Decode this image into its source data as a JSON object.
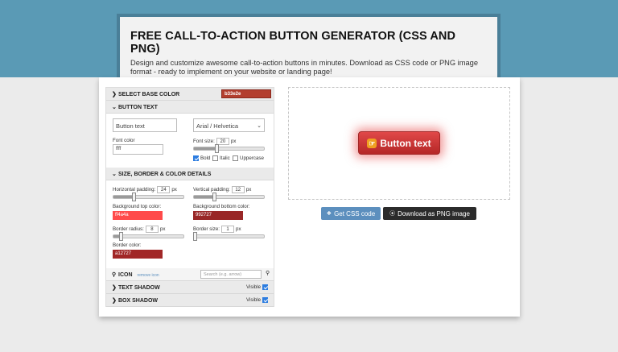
{
  "header": {
    "title": "FREE CALL-TO-ACTION BUTTON GENERATOR (CSS AND PNG)",
    "subtitle": "Design and customize awesome call-to-action buttons in minutes. Download as CSS code or PNG image format - ready to implement on your website or landing page!"
  },
  "sections": {
    "base_color": {
      "label": "SELECT BASE COLOR",
      "value": "b33e2e"
    },
    "button_text": {
      "label": "BUTTON TEXT",
      "text_value": "Button text",
      "font_family": "Arial / Helvetica",
      "font_color_label": "Font color",
      "font_color_value": "ffff",
      "font_size_label": "Font size:",
      "font_size_value": "20",
      "font_size_unit": "px",
      "font_size_level": 0.33,
      "bold_label": "Bold",
      "italic_label": "Italic",
      "uppercase_label": "Uppercase"
    },
    "size_border": {
      "label": "SIZE, BORDER & COLOR DETAILS",
      "h_padding_label": "Horizontal padding:",
      "h_padding_value": "24",
      "h_padding_level": 0.3,
      "v_padding_label": "Vertical padding:",
      "v_padding_value": "12",
      "v_padding_level": 0.3,
      "unit": "px",
      "bg_top_label": "Background top color:",
      "bg_top_value": "ff4a4a",
      "bg_top_color": "#ff4a4a",
      "bg_bottom_label": "Background bottom color:",
      "bg_bottom_value": "992727",
      "bg_bottom_color": "#992727",
      "radius_label": "Border radius:",
      "radius_value": "8",
      "radius_level": 0.12,
      "border_size_label": "Border size:",
      "border_size_value": "1",
      "border_size_level": 0.02,
      "border_color_label": "Border color:",
      "border_color_value": "a12727",
      "border_color": "#a12727"
    },
    "icon": {
      "label": "ICON",
      "remove_label": "remove icon",
      "search_placeholder": "Search (e.g. arrow)"
    },
    "text_shadow": {
      "label": "TEXT SHADOW",
      "visible_label": "Visible"
    },
    "box_shadow": {
      "label": "BOX SHADOW",
      "visible_label": "Visible"
    }
  },
  "preview": {
    "button_label": "Button text",
    "button_icon": "hand-icon"
  },
  "actions": {
    "css_label": "Get CSS code",
    "png_label": "Download as PNG image"
  },
  "colors": {
    "base": "#b33e2e",
    "accent_blue": "#5c8fbe",
    "band": "#5a9ab5"
  }
}
